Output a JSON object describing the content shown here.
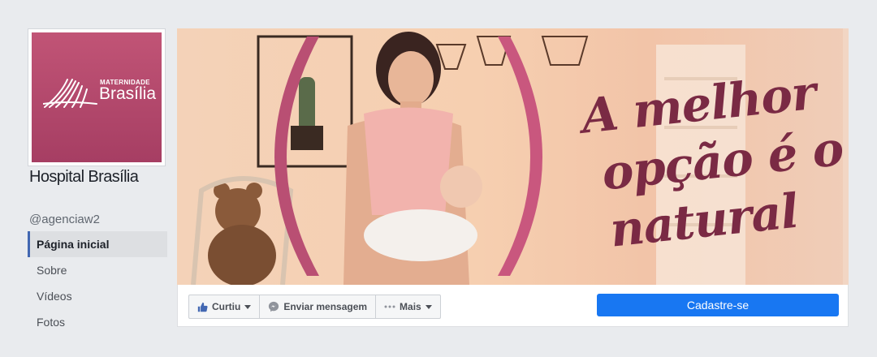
{
  "profile": {
    "logo_small": "MATERNIDADE",
    "logo_big": "Brasília",
    "name": "Hospital Brasília",
    "username": "@agenciaw2"
  },
  "nav": {
    "items": [
      {
        "label": "Página inicial",
        "active": true
      },
      {
        "label": "Sobre",
        "active": false
      },
      {
        "label": "Vídeos",
        "active": false
      },
      {
        "label": "Fotos",
        "active": false
      }
    ]
  },
  "cover": {
    "tagline": [
      "A melhor",
      "opção é o",
      "natural"
    ]
  },
  "actions": {
    "like_label": "Curtiu",
    "message_label": "Enviar mensagem",
    "more_label": "Mais",
    "signup_label": "Cadastre-se"
  },
  "colors": {
    "brand": "#a63e63",
    "accent": "#1877f2",
    "tagline": "#7a2a44"
  }
}
